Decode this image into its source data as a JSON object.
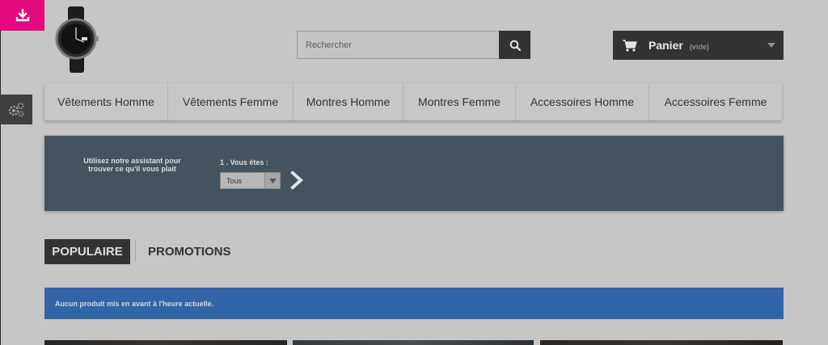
{
  "search": {
    "placeholder": "Rechercher"
  },
  "cart": {
    "label": "Panier",
    "status": "(vide)"
  },
  "nav": {
    "items": [
      "Vêtements Homme",
      "Vêtements Femme",
      "Montres Homme",
      "Montres Femme",
      "Accessoires Homme",
      "Accessoires Femme"
    ]
  },
  "assistant": {
    "intro": "Utilisez notre assistant pour trouver ce qu'il vous plait",
    "step_label": "1 . Vous êtes :",
    "selected_option": "Tous"
  },
  "tabs": {
    "popular": "POPULAIRE",
    "promotions": "PROMOTIONS"
  },
  "alert": {
    "message": "Aucun produit mis en avant à l'heure actuelle."
  },
  "colors": {
    "download_button": "#e5097f",
    "dark": "#333333",
    "assistant_bg": "#44535d",
    "alert_bg": "#3264a8"
  },
  "icons": {
    "download": "download-icon",
    "settings": "gears-icon",
    "search": "search-icon",
    "cart": "cart-icon",
    "dropdown": "chevron-down-icon",
    "next": "chevron-right-icon"
  }
}
